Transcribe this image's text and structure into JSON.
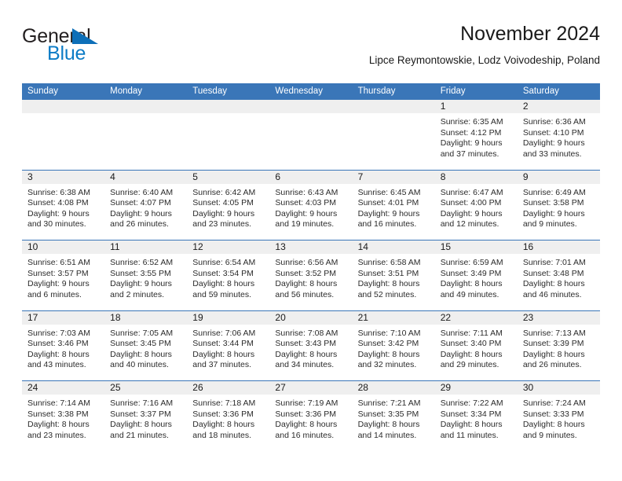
{
  "brand": {
    "name_part1": "General",
    "name_part2": "Blue"
  },
  "header": {
    "title": "November 2024",
    "subtitle": "Lipce Reymontowskie, Lodz Voivodeship, Poland"
  },
  "colors": {
    "header_blue": "#3a76b8",
    "daynum_band": "#efefef",
    "logo_blue": "#0d7cc6",
    "text": "#1a1a1a"
  },
  "weekdays": [
    "Sunday",
    "Monday",
    "Tuesday",
    "Wednesday",
    "Thursday",
    "Friday",
    "Saturday"
  ],
  "weeks": [
    [
      {
        "day": "",
        "lines": []
      },
      {
        "day": "",
        "lines": []
      },
      {
        "day": "",
        "lines": []
      },
      {
        "day": "",
        "lines": []
      },
      {
        "day": "",
        "lines": []
      },
      {
        "day": "1",
        "lines": [
          "Sunrise: 6:35 AM",
          "Sunset: 4:12 PM",
          "Daylight: 9 hours",
          "and 37 minutes."
        ]
      },
      {
        "day": "2",
        "lines": [
          "Sunrise: 6:36 AM",
          "Sunset: 4:10 PM",
          "Daylight: 9 hours",
          "and 33 minutes."
        ]
      }
    ],
    [
      {
        "day": "3",
        "lines": [
          "Sunrise: 6:38 AM",
          "Sunset: 4:08 PM",
          "Daylight: 9 hours",
          "and 30 minutes."
        ]
      },
      {
        "day": "4",
        "lines": [
          "Sunrise: 6:40 AM",
          "Sunset: 4:07 PM",
          "Daylight: 9 hours",
          "and 26 minutes."
        ]
      },
      {
        "day": "5",
        "lines": [
          "Sunrise: 6:42 AM",
          "Sunset: 4:05 PM",
          "Daylight: 9 hours",
          "and 23 minutes."
        ]
      },
      {
        "day": "6",
        "lines": [
          "Sunrise: 6:43 AM",
          "Sunset: 4:03 PM",
          "Daylight: 9 hours",
          "and 19 minutes."
        ]
      },
      {
        "day": "7",
        "lines": [
          "Sunrise: 6:45 AM",
          "Sunset: 4:01 PM",
          "Daylight: 9 hours",
          "and 16 minutes."
        ]
      },
      {
        "day": "8",
        "lines": [
          "Sunrise: 6:47 AM",
          "Sunset: 4:00 PM",
          "Daylight: 9 hours",
          "and 12 minutes."
        ]
      },
      {
        "day": "9",
        "lines": [
          "Sunrise: 6:49 AM",
          "Sunset: 3:58 PM",
          "Daylight: 9 hours",
          "and 9 minutes."
        ]
      }
    ],
    [
      {
        "day": "10",
        "lines": [
          "Sunrise: 6:51 AM",
          "Sunset: 3:57 PM",
          "Daylight: 9 hours",
          "and 6 minutes."
        ]
      },
      {
        "day": "11",
        "lines": [
          "Sunrise: 6:52 AM",
          "Sunset: 3:55 PM",
          "Daylight: 9 hours",
          "and 2 minutes."
        ]
      },
      {
        "day": "12",
        "lines": [
          "Sunrise: 6:54 AM",
          "Sunset: 3:54 PM",
          "Daylight: 8 hours",
          "and 59 minutes."
        ]
      },
      {
        "day": "13",
        "lines": [
          "Sunrise: 6:56 AM",
          "Sunset: 3:52 PM",
          "Daylight: 8 hours",
          "and 56 minutes."
        ]
      },
      {
        "day": "14",
        "lines": [
          "Sunrise: 6:58 AM",
          "Sunset: 3:51 PM",
          "Daylight: 8 hours",
          "and 52 minutes."
        ]
      },
      {
        "day": "15",
        "lines": [
          "Sunrise: 6:59 AM",
          "Sunset: 3:49 PM",
          "Daylight: 8 hours",
          "and 49 minutes."
        ]
      },
      {
        "day": "16",
        "lines": [
          "Sunrise: 7:01 AM",
          "Sunset: 3:48 PM",
          "Daylight: 8 hours",
          "and 46 minutes."
        ]
      }
    ],
    [
      {
        "day": "17",
        "lines": [
          "Sunrise: 7:03 AM",
          "Sunset: 3:46 PM",
          "Daylight: 8 hours",
          "and 43 minutes."
        ]
      },
      {
        "day": "18",
        "lines": [
          "Sunrise: 7:05 AM",
          "Sunset: 3:45 PM",
          "Daylight: 8 hours",
          "and 40 minutes."
        ]
      },
      {
        "day": "19",
        "lines": [
          "Sunrise: 7:06 AM",
          "Sunset: 3:44 PM",
          "Daylight: 8 hours",
          "and 37 minutes."
        ]
      },
      {
        "day": "20",
        "lines": [
          "Sunrise: 7:08 AM",
          "Sunset: 3:43 PM",
          "Daylight: 8 hours",
          "and 34 minutes."
        ]
      },
      {
        "day": "21",
        "lines": [
          "Sunrise: 7:10 AM",
          "Sunset: 3:42 PM",
          "Daylight: 8 hours",
          "and 32 minutes."
        ]
      },
      {
        "day": "22",
        "lines": [
          "Sunrise: 7:11 AM",
          "Sunset: 3:40 PM",
          "Daylight: 8 hours",
          "and 29 minutes."
        ]
      },
      {
        "day": "23",
        "lines": [
          "Sunrise: 7:13 AM",
          "Sunset: 3:39 PM",
          "Daylight: 8 hours",
          "and 26 minutes."
        ]
      }
    ],
    [
      {
        "day": "24",
        "lines": [
          "Sunrise: 7:14 AM",
          "Sunset: 3:38 PM",
          "Daylight: 8 hours",
          "and 23 minutes."
        ]
      },
      {
        "day": "25",
        "lines": [
          "Sunrise: 7:16 AM",
          "Sunset: 3:37 PM",
          "Daylight: 8 hours",
          "and 21 minutes."
        ]
      },
      {
        "day": "26",
        "lines": [
          "Sunrise: 7:18 AM",
          "Sunset: 3:36 PM",
          "Daylight: 8 hours",
          "and 18 minutes."
        ]
      },
      {
        "day": "27",
        "lines": [
          "Sunrise: 7:19 AM",
          "Sunset: 3:36 PM",
          "Daylight: 8 hours",
          "and 16 minutes."
        ]
      },
      {
        "day": "28",
        "lines": [
          "Sunrise: 7:21 AM",
          "Sunset: 3:35 PM",
          "Daylight: 8 hours",
          "and 14 minutes."
        ]
      },
      {
        "day": "29",
        "lines": [
          "Sunrise: 7:22 AM",
          "Sunset: 3:34 PM",
          "Daylight: 8 hours",
          "and 11 minutes."
        ]
      },
      {
        "day": "30",
        "lines": [
          "Sunrise: 7:24 AM",
          "Sunset: 3:33 PM",
          "Daylight: 8 hours",
          "and 9 minutes."
        ]
      }
    ]
  ]
}
